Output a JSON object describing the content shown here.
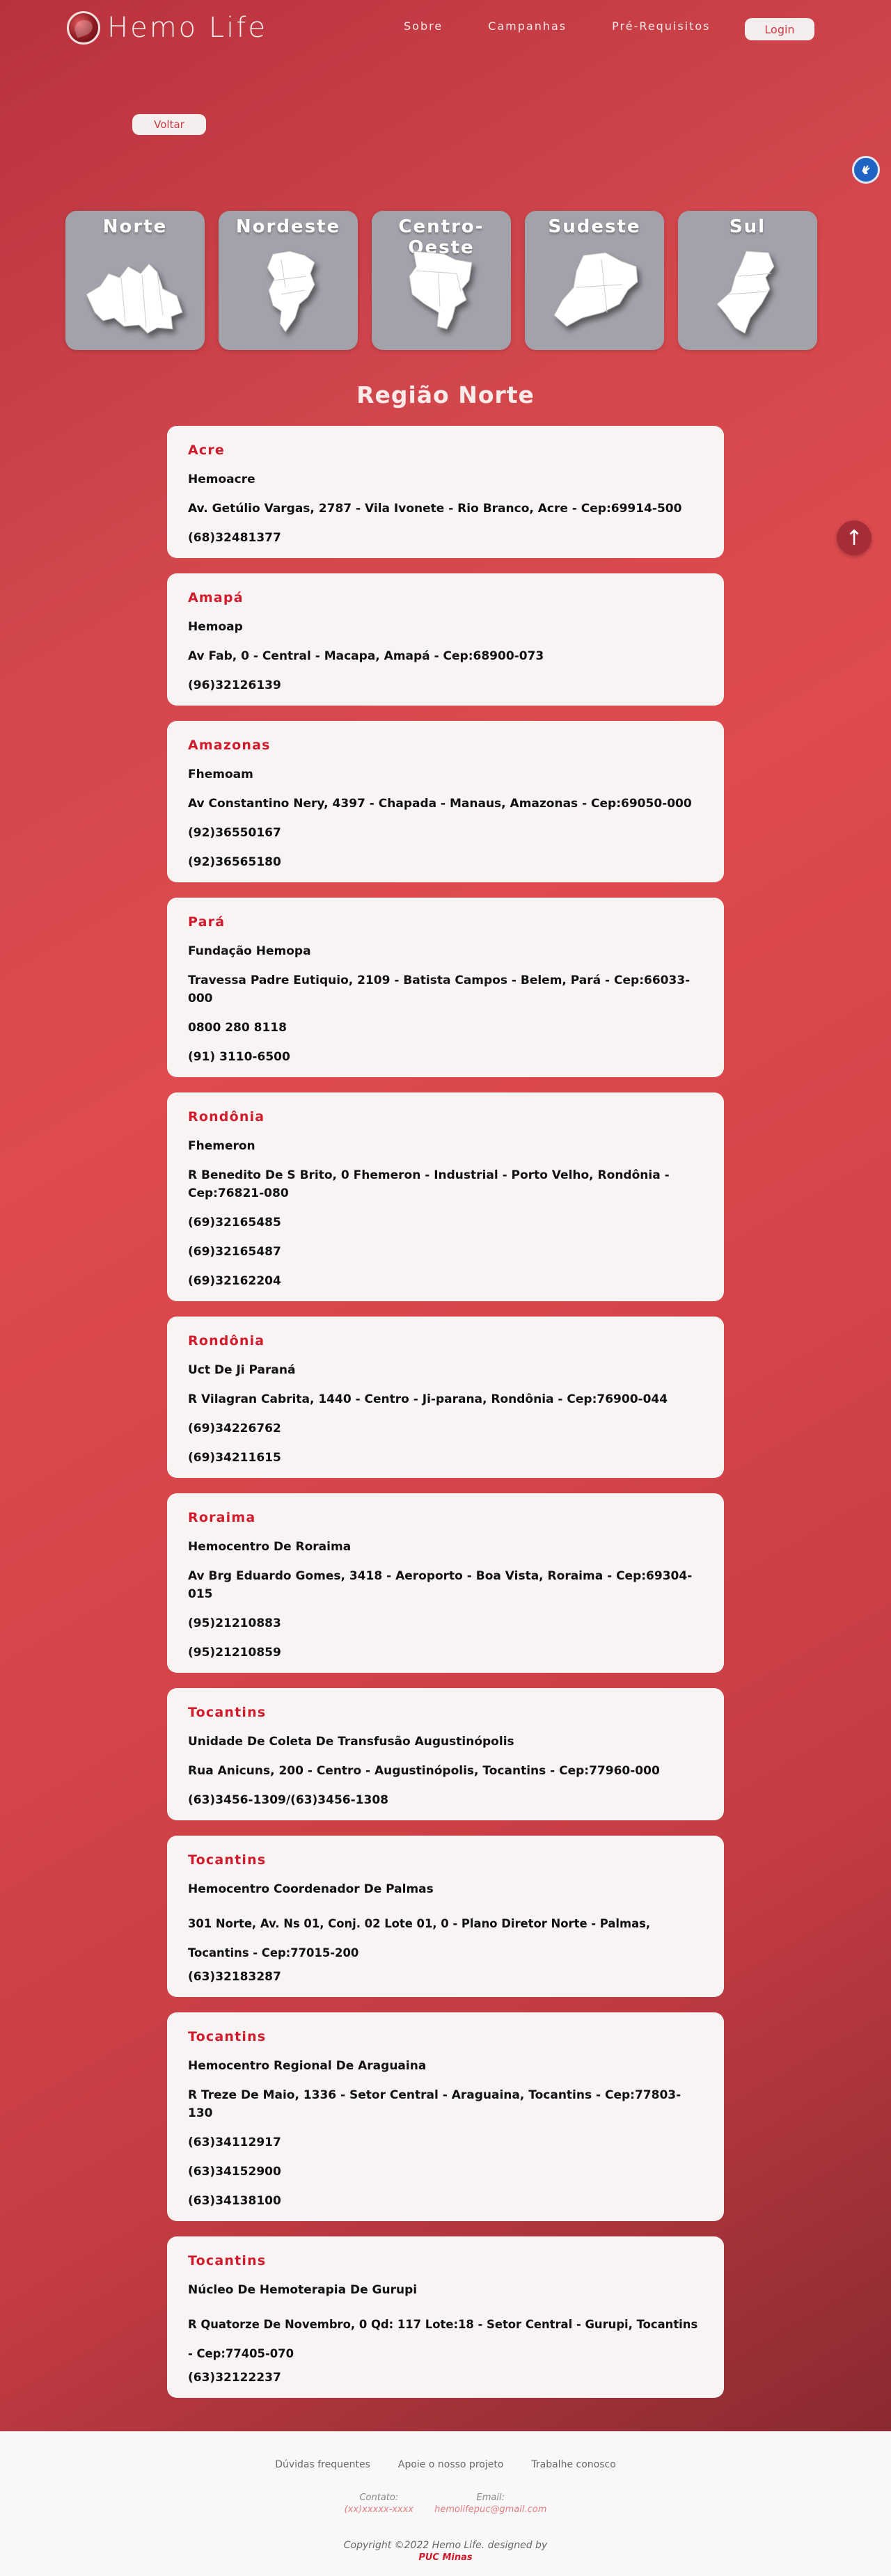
{
  "header": {
    "logo_text": "Hemo Life",
    "nav": [
      "Sobre",
      "Campanhas",
      "Pré-Requisitos"
    ],
    "login_label": "Login"
  },
  "back_label": "Voltar",
  "regions": [
    {
      "name": "Norte"
    },
    {
      "name": "Nordeste"
    },
    {
      "name": "Centro-Oeste"
    },
    {
      "name": "Sudeste"
    },
    {
      "name": "Sul"
    }
  ],
  "section_title": "Região Norte",
  "centers": [
    {
      "state": "Acre",
      "name": "Hemoacre",
      "address": "Av. Getúlio Vargas, 2787 - Vila Ivonete - Rio Branco, Acre - Cep:69914-500",
      "phones": [
        "(68)32481377"
      ]
    },
    {
      "state": "Amapá",
      "name": "Hemoap",
      "address": "Av Fab, 0 - Central - Macapa, Amapá - Cep:68900-073",
      "phones": [
        "(96)32126139"
      ]
    },
    {
      "state": "Amazonas",
      "name": "Fhemoam",
      "address": "Av Constantino Nery, 4397 - Chapada - Manaus, Amazonas - Cep:69050-000",
      "phones": [
        "(92)36550167",
        "(92)36565180"
      ]
    },
    {
      "state": "Pará",
      "name": "Fundação Hemopa",
      "address": "Travessa Padre Eutiquio, 2109 - Batista Campos - Belem, Pará - Cep:66033-000",
      "phones": [
        "0800 280 8118",
        "(91) 3110-6500"
      ]
    },
    {
      "state": "Rondônia",
      "name": "Fhemeron",
      "address": "R Benedito De S Brito, 0 Fhemeron - Industrial - Porto Velho, Rondônia - Cep:76821-080",
      "phones": [
        "(69)32165485",
        "(69)32165487",
        "(69)32162204"
      ]
    },
    {
      "state": "Rondônia",
      "name": "Uct De Ji Paraná",
      "address": "R Vilagran Cabrita, 1440 - Centro - Ji-parana, Rondônia - Cep:76900-044",
      "phones": [
        "(69)34226762",
        "(69)34211615"
      ]
    },
    {
      "state": "Roraima",
      "name": "Hemocentro De Roraima",
      "address": "Av Brg Eduardo Gomes, 3418 - Aeroporto - Boa Vista, Roraima - Cep:69304-015",
      "phones": [
        "(95)21210883",
        "(95)21210859"
      ]
    },
    {
      "state": "Tocantins",
      "name": "Unidade De Coleta De Transfusão Augustinópolis",
      "address": "Rua Anicuns, 200 - Centro - Augustinópolis, Tocantins - Cep:77960-000",
      "phones": [
        "(63)3456-1309/(63)3456-1308"
      ]
    },
    {
      "state": "Tocantins",
      "name": "Hemocentro Coordenador De Palmas",
      "address": "301 Norte, Av. Ns 01, Conj. 02 Lote 01, 0 - Plano Diretor Norte - Palmas, Tocantins - Cep:77015-200",
      "phones": [
        "(63)32183287"
      ]
    },
    {
      "state": "Tocantins",
      "name": "Hemocentro Regional De Araguaina",
      "address": "R Treze De Maio, 1336 - Setor Central - Araguaina, Tocantins - Cep:77803-130",
      "phones": [
        "(63)34112917",
        "(63)34152900",
        "(63)34138100"
      ]
    },
    {
      "state": "Tocantins",
      "name": "Núcleo De Hemoterapia De Gurupi",
      "address": "R Quatorze De Novembro, 0 Qd: 117 Lote:18 - Setor Central - Gurupi, Tocantins - Cep:77405-070",
      "phones": [
        "(63)32122237"
      ]
    }
  ],
  "footer": {
    "links": [
      "Dúvidas frequentes",
      "Apoie o nosso projeto",
      "Trabalhe conosco"
    ],
    "contact_label": "Contato:",
    "contact_value": "(xx)xxxxx-xxxx",
    "email_label": "Email:",
    "email_value": "hemolifepuc@gmail.com",
    "copyright": "Copyright ©2022 Hemo Life. designed by",
    "designed_by": "PUC Minas"
  },
  "icons": {
    "accessibility": "sign-language-icon",
    "back_to_top": "arrow-up-icon"
  },
  "colors": {
    "accent": "#d11b2c",
    "card_bg": "#f8f4f3",
    "region_card_bg": "#a2a2aa",
    "a11y_bg": "#1f63c3"
  }
}
